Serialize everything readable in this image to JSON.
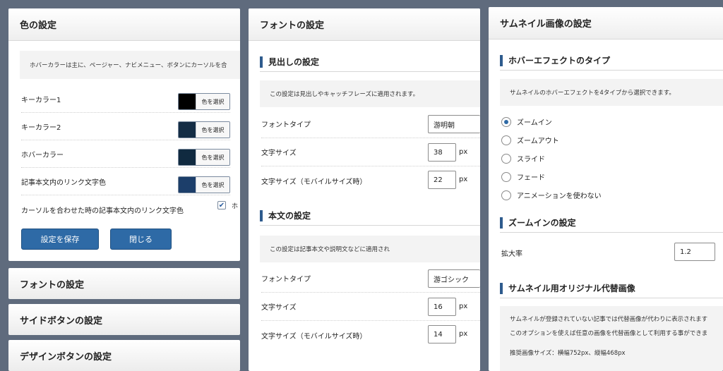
{
  "color_panel": {
    "title": "色の設定",
    "note": "ホバーカラーは主に、ページャー、ナビメニュー、ボタンにカーソルを合",
    "rows": [
      {
        "label": "キーカラー1",
        "button": "色を選択",
        "color": "#000000"
      },
      {
        "label": "キーカラー2",
        "button": "色を選択",
        "color": "#142d45"
      },
      {
        "label": "ホバーカラー",
        "button": "色を選択",
        "color": "#102a40"
      },
      {
        "label": "記事本文内のリンク文字色",
        "button": "色を選択",
        "color": "#1c3e6a"
      }
    ],
    "hover_link_label": "カーソルを合わせた時の記事本文内のリンク文字色",
    "hover_link_checkbox_label": "ホ",
    "save_button": "設定を保存",
    "close_button": "閉じる"
  },
  "collapsed_panels": [
    {
      "title": "フォントの設定"
    },
    {
      "title": "サイドボタンの設定"
    },
    {
      "title": "デザインボタンの設定"
    }
  ],
  "font_panel": {
    "title": "フォントの設定",
    "heading_section": {
      "title": "見出しの設定",
      "note": "この設定は見出しやキャッチフレーズに適用されます。",
      "font_type_label": "フォントタイプ",
      "font_type_value": "游明朝",
      "size_label": "文字サイズ",
      "size_value": "38",
      "mobile_size_label": "文字サイズ（モバイルサイズ時）",
      "mobile_size_value": "22",
      "unit": "px"
    },
    "body_section": {
      "title": "本文の設定",
      "note": "この設定は記事本文や説明文などに適用され",
      "font_type_label": "フォントタイプ",
      "font_type_value": "游ゴシック",
      "size_label": "文字サイズ",
      "size_value": "16",
      "mobile_size_label": "文字サイズ（モバイルサイズ時）",
      "mobile_size_value": "14",
      "unit": "px"
    }
  },
  "thumb_panel": {
    "title": "サムネイル画像の設定",
    "hover_section": {
      "title": "ホバーエフェクトのタイプ",
      "note": "サムネイルのホバーエフェクトを4タイプから選択できます。",
      "options": [
        {
          "label": "ズームイン",
          "selected": true
        },
        {
          "label": "ズームアウト",
          "selected": false
        },
        {
          "label": "スライド",
          "selected": false
        },
        {
          "label": "フェード",
          "selected": false
        },
        {
          "label": "アニメーションを使わない",
          "selected": false
        }
      ]
    },
    "zoom_section": {
      "title": "ズームインの設定",
      "scale_label": "拡大率",
      "scale_value": "1.2"
    },
    "alt_section": {
      "title": "サムネイル用オリジナル代替画像",
      "line1": "サムネイルが登録されていない記事では代替画像が代わりに表示されます",
      "line2": "このオプションを使えば任意の画像を代替画像として利用する事ができま",
      "line3": "推奨画像サイズ：横幅752px、縦幅468px"
    }
  }
}
